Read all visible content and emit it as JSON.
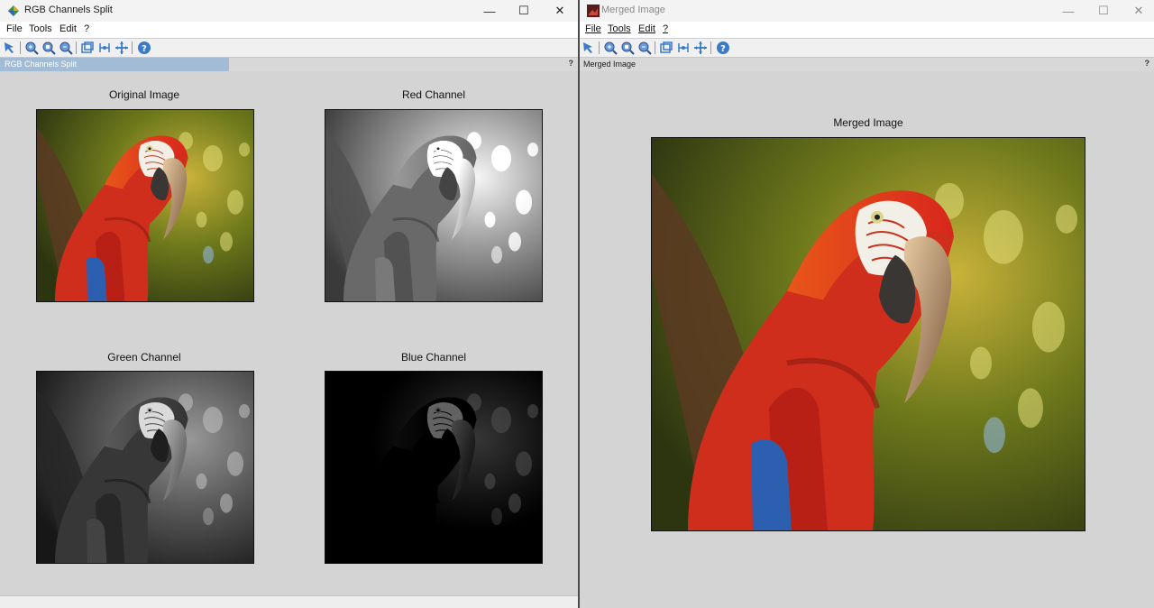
{
  "left_window": {
    "title": "RGB Channels Split",
    "menu": [
      "File",
      "Tools",
      "Edit",
      "?"
    ],
    "panel_tab": "RGB Channels Split",
    "help": "?",
    "plots": [
      {
        "title": "Original Image",
        "channel": "original"
      },
      {
        "title": "Red Channel",
        "channel": "red"
      },
      {
        "title": "Green Channel",
        "channel": "green"
      },
      {
        "title": "Blue Channel",
        "channel": "blue"
      }
    ],
    "app_icon": "figure-app-icon"
  },
  "right_window": {
    "title": "Merged Image",
    "menu": [
      "File",
      "Tools",
      "Edit",
      "?"
    ],
    "panel_tab": "Merged Image",
    "help": "?",
    "plot_title": "Merged Image",
    "app_icon": "image-app-icon"
  },
  "window_controls": {
    "minimize": "—",
    "maximize": "☐",
    "close": "✕"
  },
  "toolbar_icons": [
    "select-arrow-icon",
    "zoom-in-icon",
    "zoom-region-icon",
    "zoom-out-icon",
    "window-icon",
    "data-cursor-icon",
    "pan-icon",
    "help-icon"
  ],
  "colors": {
    "accent_tab": "#a3bcd6",
    "figure_bg": "#d4d4d4",
    "divider": "#4a4a4a"
  }
}
